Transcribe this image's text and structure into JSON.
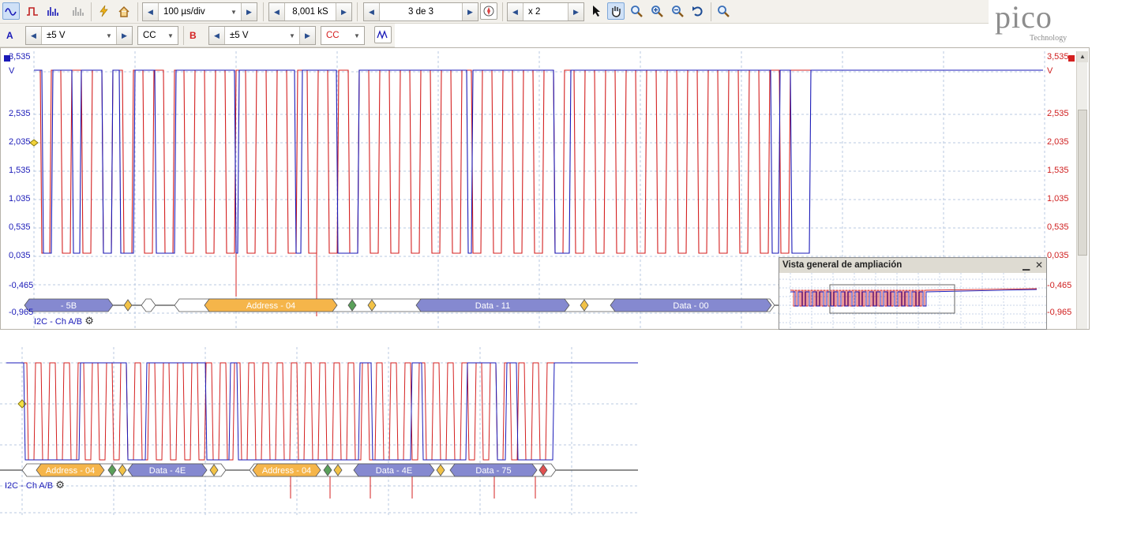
{
  "toolbar_top": {
    "timebase": "100 µs/div",
    "samples": "8,001 kS",
    "capture": "3 de 3",
    "zoom": "x 2",
    "icons": [
      "scope-mode-icon",
      "persistence-mode-icon",
      "spectrum-mode-icon",
      "persistence-spectrum-icon",
      "trigger-lightning-icon",
      "home-icon",
      "compass-icon",
      "pointer-icon",
      "hand-icon",
      "zoom-icon",
      "zoom-in-icon",
      "zoom-out-icon",
      "undo-zoom-icon",
      "zoom-100-icon"
    ]
  },
  "toolbar_channels": {
    "a_label": "A",
    "a_range": "±5 V",
    "a_coupling": "CC",
    "b_label": "B",
    "b_range": "±5 V",
    "b_coupling": "CC",
    "math_icon": "math-channels-icon"
  },
  "logo": {
    "word": "pico",
    "sub": "Technology"
  },
  "axis": {
    "left_ticks": [
      "3,535",
      "V",
      "2,535",
      "2,035",
      "1,535",
      "1,035",
      "0,535",
      "0,035",
      "-0,465",
      "-0,965"
    ],
    "right_ticks": [
      "3,535",
      "V",
      "2,535",
      "2,035",
      "1,535",
      "1,035",
      "0,535",
      "0,035",
      "-0,465",
      "-0,965"
    ]
  },
  "colors": {
    "channel_a": "#1a1ab8",
    "channel_b": "#d42020",
    "address": "#f5b54a",
    "data": "#8589d0",
    "ack": "#f2c246"
  },
  "decode_top": {
    "label": "I2C - Ch A/B",
    "packets": [
      "- 5B",
      "Address - 04",
      "Data - 11",
      "Data - 00"
    ]
  },
  "zoom_overview": {
    "title": "Vista general de ampliación"
  },
  "decode_bottom": {
    "label": "I2C - Ch A/B",
    "packets": [
      "Address - 04",
      "Data - 4E",
      "Address - 04",
      "Data - 4E",
      "Data - 75"
    ]
  }
}
